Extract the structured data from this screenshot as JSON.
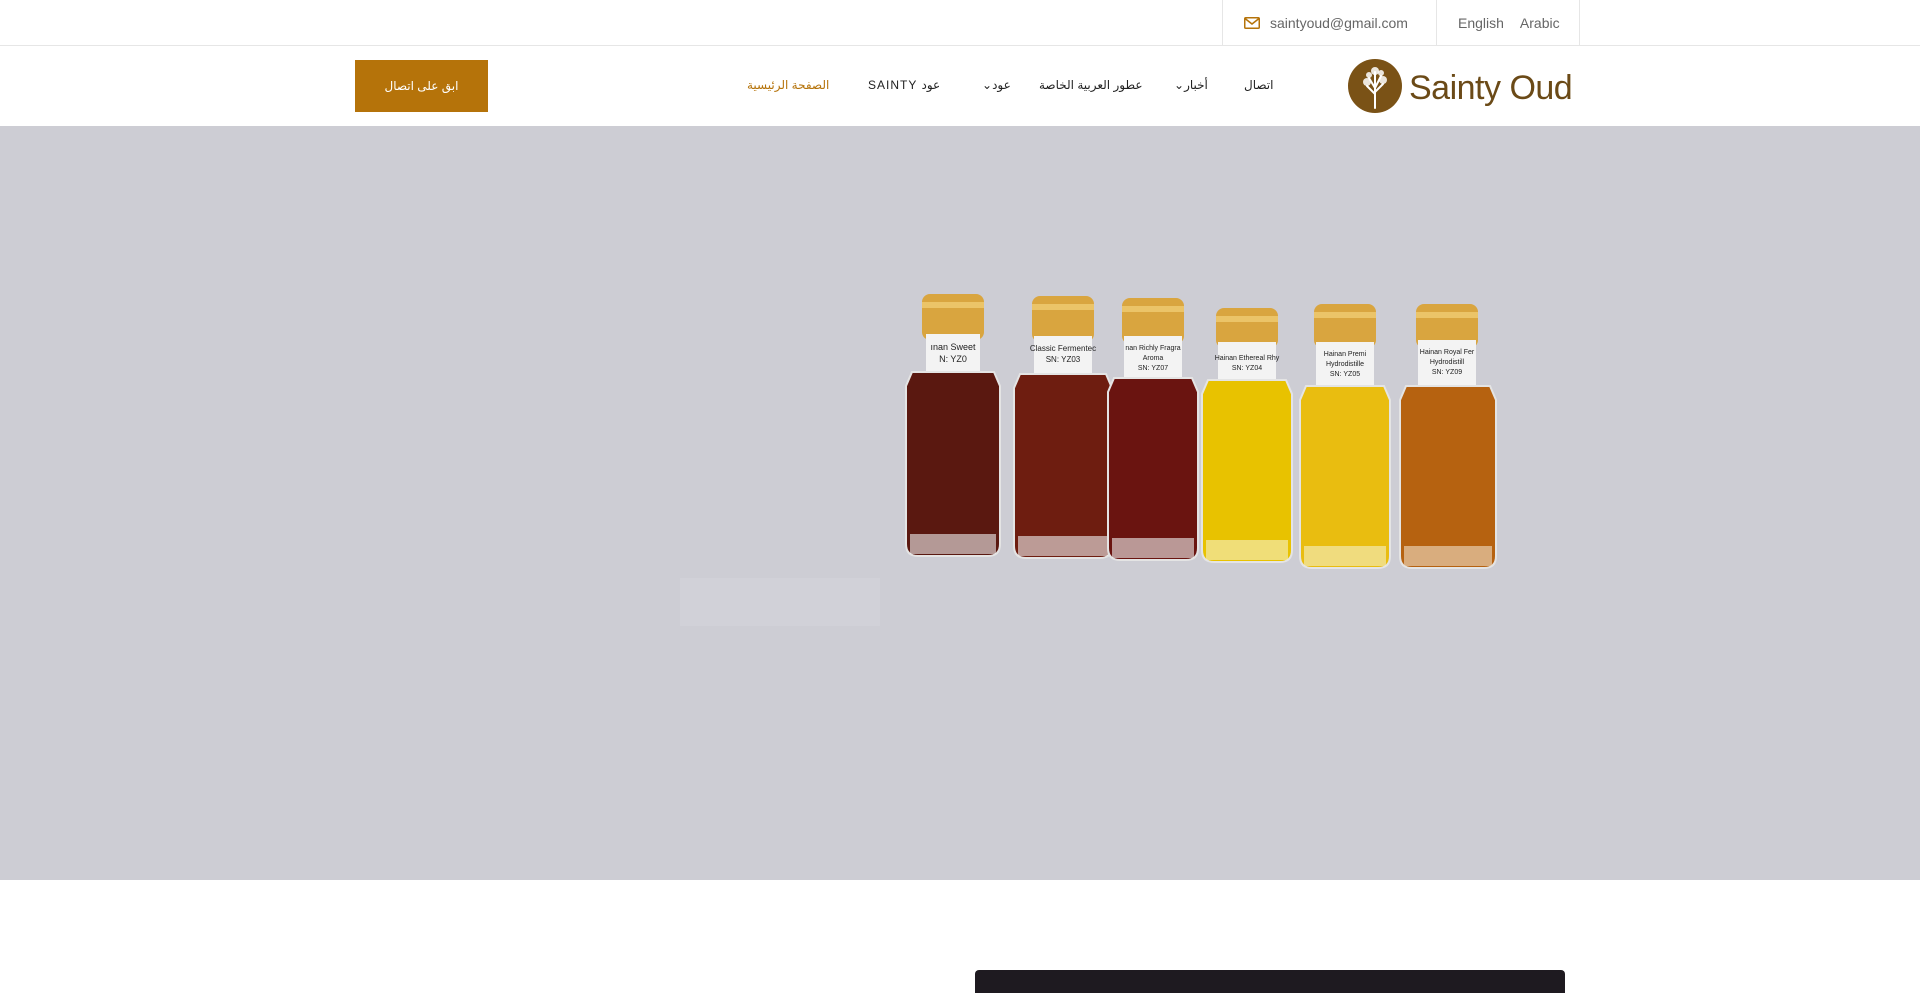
{
  "topbar": {
    "email": "saintyoud@gmail.com",
    "languages": [
      "English",
      "Arabic"
    ]
  },
  "header": {
    "cta_label": "ابق على اتصال",
    "nav": [
      {
        "label": "الصفحة الرئيسية",
        "active": true
      },
      {
        "label": "SAINTY عود",
        "active": false
      },
      {
        "label": "⌄عود",
        "active": false
      },
      {
        "label": "عطور العربية الخاصة",
        "active": false
      },
      {
        "label": "⌄أخبار",
        "active": false
      },
      {
        "label": "اتصال",
        "active": false
      }
    ],
    "logo_text": "Sainty Oud"
  },
  "hero": {
    "bottles": [
      {
        "label_line1": "ınan Sweet",
        "label_line2": "N: YZ0",
        "color": "#5a1810"
      },
      {
        "label_line1": "Classic Fermentec",
        "label_line2": "SN: YZ03",
        "color": "#6e1d10"
      },
      {
        "label_line1": "nan Richly Fragra",
        "label_line2": "Aroma",
        "label_line3": "SN: YZ07",
        "color": "#6a1410"
      },
      {
        "label_line1": "Hainan Ethereal Rhy",
        "label_line2": "SN: YZ04",
        "color": "#e8c200"
      },
      {
        "label_line1": "Hainan Premi",
        "label_line2": "Hydrodistille",
        "label_line3": "SN: YZ05",
        "color": "#e9bd10"
      },
      {
        "label_line1": "Hainan Royal Fer",
        "label_line2": "Hydrodistill",
        "label_line3": "SN: YZ09",
        "color": "#b66210"
      }
    ]
  },
  "colors": {
    "accent": "#b5730a",
    "hero_bg": "#cdcdd4",
    "logo": "#6b4a17"
  }
}
